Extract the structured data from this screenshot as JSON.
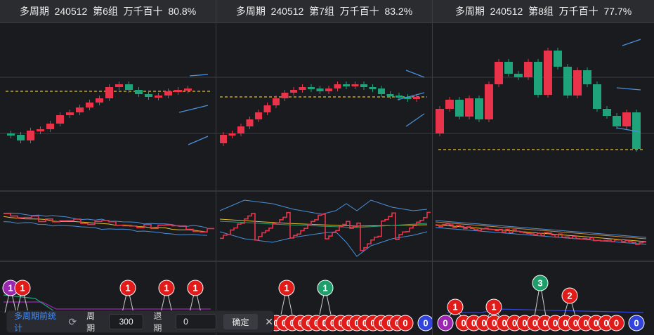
{
  "panels": [
    {
      "title": "多周期  240512  第6组  万千百十  80.8%"
    },
    {
      "title": "多周期  240512  第7组  万千百十  83.2%"
    },
    {
      "title": "多周期  240512  第8组  万千百十  77.7%"
    }
  ],
  "stats": {
    "label": "多周期前统计",
    "period_label": "周期",
    "period_value": "300",
    "back_label": "退期",
    "back_value": "0",
    "confirm": "确定"
  },
  "badges": {
    "p1": [
      "1",
      "1",
      "1",
      "1",
      "1"
    ],
    "p2": [
      "1",
      "1",
      "0",
      "0",
      "0",
      "0",
      "0",
      "0",
      "0",
      "0",
      "0",
      "0",
      "0",
      "0",
      "0",
      "0",
      "0",
      "0",
      "0",
      "0"
    ],
    "p3": [
      "0",
      "1",
      "1",
      "3",
      "2",
      "0",
      "0",
      "0",
      "0",
      "0",
      "0",
      "0",
      "0",
      "0",
      "0",
      "0",
      "0",
      "0",
      "0",
      "0",
      "0",
      "0"
    ]
  },
  "colors": {
    "up": "#e8334a",
    "down": "#1fa37a",
    "avg": "#e5c02a",
    "band": "#4a90d9",
    "badge_red": "#e11a1a",
    "badge_green": "#1e9e6b",
    "badge_purple": "#9b27b0",
    "badge_blue": "#3344dd"
  }
}
